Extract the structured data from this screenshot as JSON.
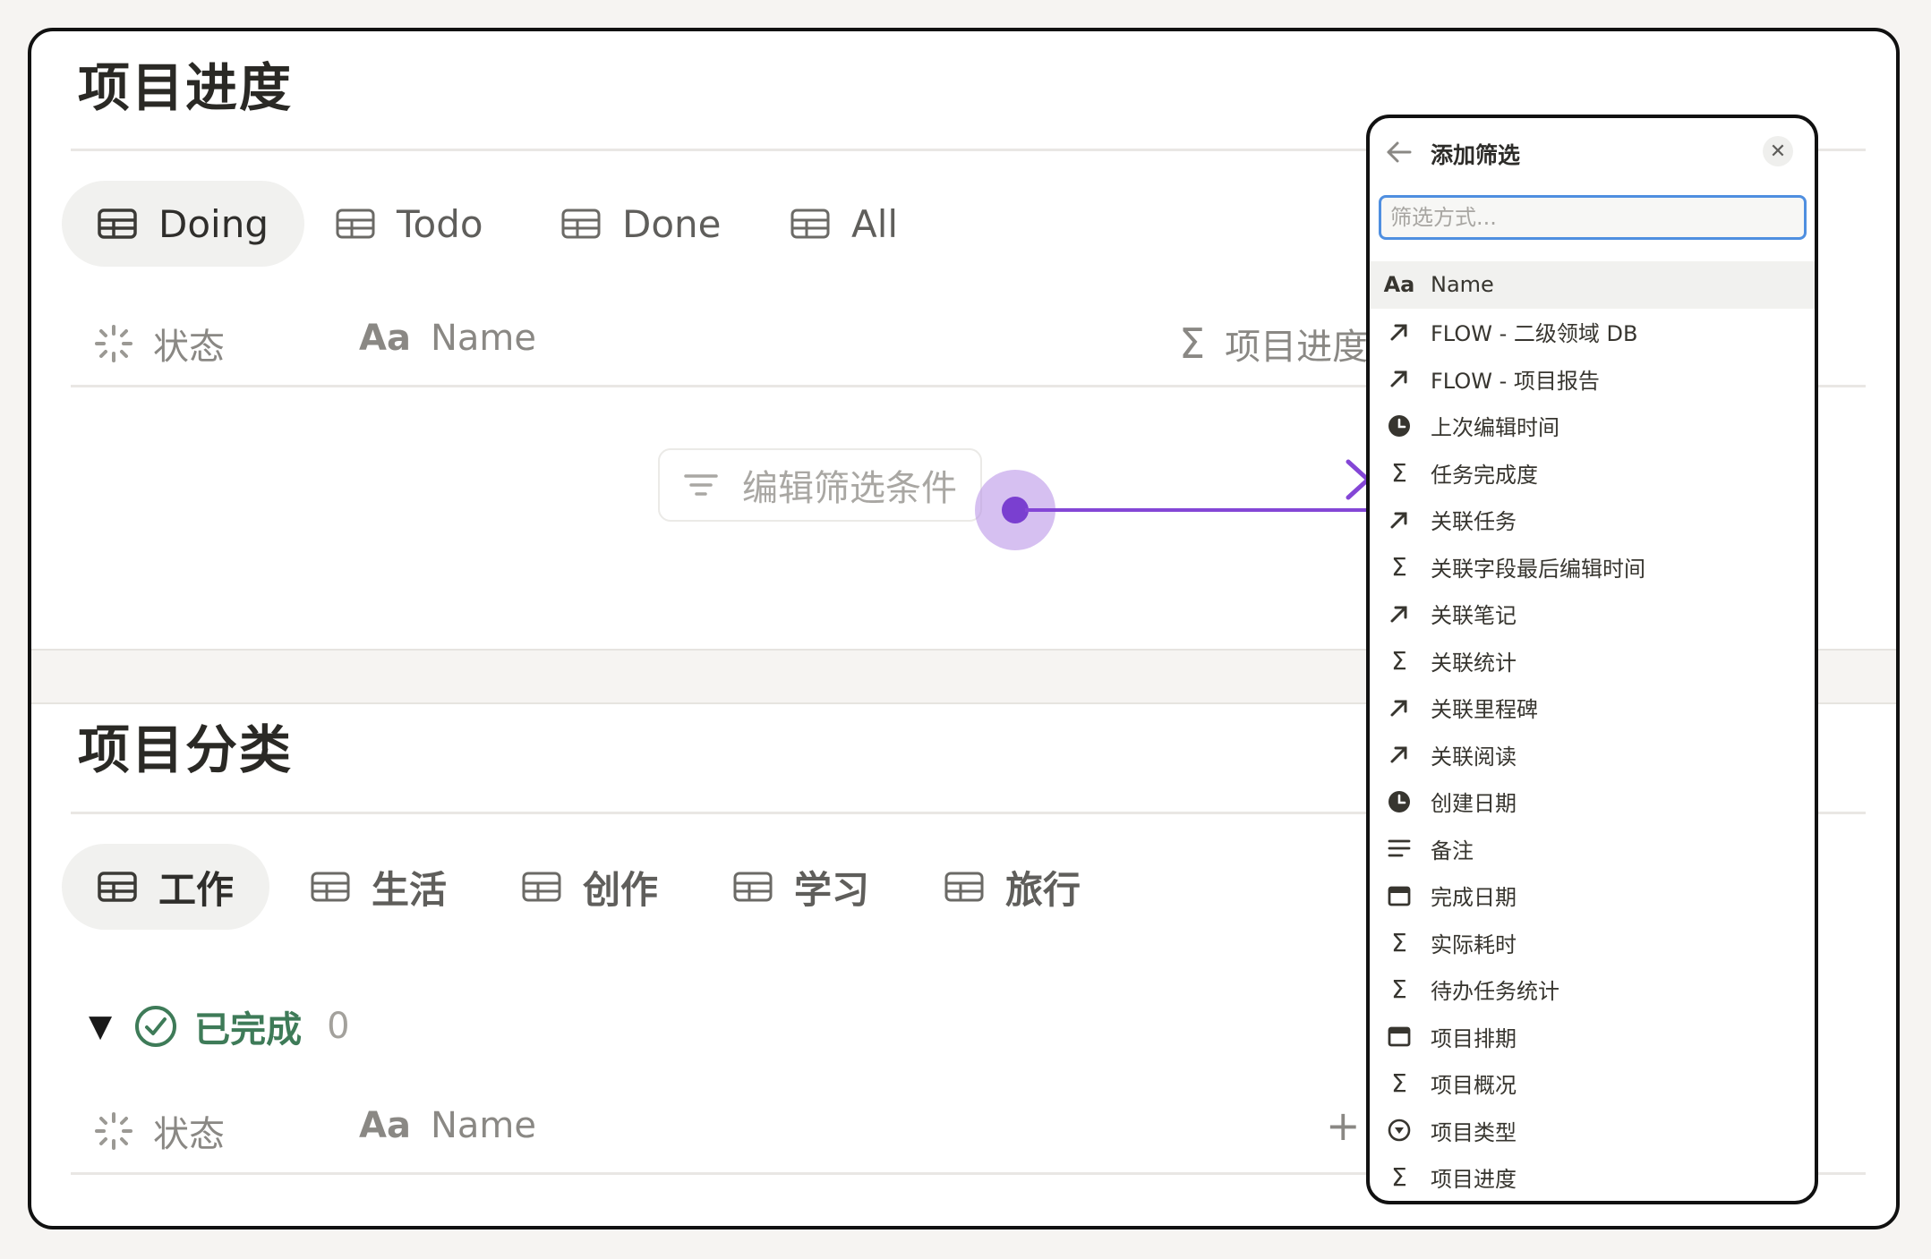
{
  "section1": {
    "title": "项目进度",
    "tabs": [
      {
        "label": "Doing",
        "active": true
      },
      {
        "label": "Todo",
        "active": false
      },
      {
        "label": "Done",
        "active": false
      },
      {
        "label": "All",
        "active": false
      }
    ],
    "columns": {
      "status": "状态",
      "name": "Name",
      "progress": "项目进度"
    },
    "filter_button": "编辑筛选条件"
  },
  "section2": {
    "title": "项目分类",
    "tabs": [
      {
        "label": "工作",
        "active": true
      },
      {
        "label": "生活",
        "active": false
      },
      {
        "label": "创作",
        "active": false
      },
      {
        "label": "学习",
        "active": false
      },
      {
        "label": "旅行",
        "active": false
      }
    ],
    "group": {
      "label": "已完成",
      "count": "0"
    },
    "columns": {
      "status": "状态",
      "name": "Name"
    }
  },
  "panel": {
    "title": "添加筛选",
    "search_placeholder": "筛选方式...",
    "items": [
      {
        "icon": "text-icon",
        "label": "Name"
      },
      {
        "icon": "relation-icon",
        "label": "FLOW - 二级领域 DB"
      },
      {
        "icon": "relation-icon",
        "label": "FLOW - 项目报告"
      },
      {
        "icon": "clock-icon",
        "label": "上次编辑时间"
      },
      {
        "icon": "sigma-icon",
        "label": "任务完成度"
      },
      {
        "icon": "relation-icon",
        "label": "关联任务"
      },
      {
        "icon": "sigma-icon",
        "label": "关联字段最后编辑时间"
      },
      {
        "icon": "relation-icon",
        "label": "关联笔记"
      },
      {
        "icon": "sigma-icon",
        "label": "关联统计"
      },
      {
        "icon": "relation-icon",
        "label": "关联里程碑"
      },
      {
        "icon": "relation-icon",
        "label": "关联阅读"
      },
      {
        "icon": "clock-icon",
        "label": "创建日期"
      },
      {
        "icon": "lines-icon",
        "label": "备注"
      },
      {
        "icon": "calendar-icon",
        "label": "完成日期"
      },
      {
        "icon": "sigma-icon",
        "label": "实际耗时"
      },
      {
        "icon": "sigma-icon",
        "label": "待办任务统计"
      },
      {
        "icon": "calendar-icon",
        "label": "项目排期"
      },
      {
        "icon": "sigma-icon",
        "label": "项目概况"
      },
      {
        "icon": "status-icon",
        "label": "项目类型"
      },
      {
        "icon": "sigma-icon",
        "label": "项目进度"
      }
    ]
  },
  "colors": {
    "accent_arrow": "#8446d6",
    "search_focus": "#4f8fe0",
    "done_green": "#3e7b58"
  }
}
